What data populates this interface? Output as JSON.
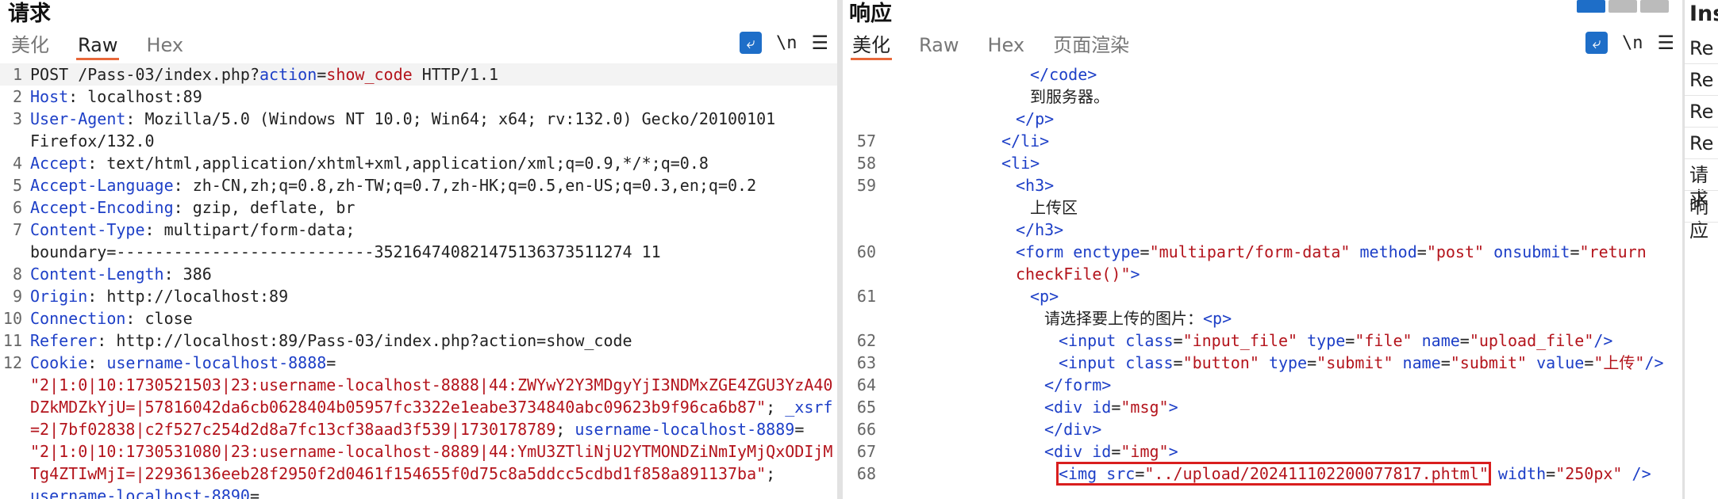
{
  "request": {
    "title": "请求",
    "tabs": [
      "美化",
      "Raw",
      "Hex"
    ],
    "active_tab": "Raw",
    "icons": {
      "wrap": "wrap-lines-icon",
      "newline": "\\n",
      "menu": "menu-icon"
    },
    "lines": [
      {
        "n": "1",
        "parts": [
          {
            "c": "txt",
            "t": "POST /Pass-03/index.php?"
          },
          {
            "c": "kw",
            "t": "action"
          },
          {
            "c": "txt",
            "t": "="
          },
          {
            "c": "val",
            "t": "show_code"
          },
          {
            "c": "txt",
            "t": " HTTP/1.1"
          }
        ],
        "first": true
      },
      {
        "n": "2",
        "parts": [
          {
            "c": "hdr",
            "t": "Host"
          },
          {
            "c": "txt",
            "t": ": localhost:89"
          }
        ]
      },
      {
        "n": "3",
        "parts": [
          {
            "c": "hdr",
            "t": "User-Agent"
          },
          {
            "c": "txt",
            "t": ": Mozilla/5.0 (Windows NT 10.0; Win64; x64; rv:132.0) Gecko/20100101"
          }
        ]
      },
      {
        "n": "",
        "parts": [
          {
            "c": "txt",
            "t": "Firefox/132.0"
          }
        ]
      },
      {
        "n": "4",
        "parts": [
          {
            "c": "hdr",
            "t": "Accept"
          },
          {
            "c": "txt",
            "t": ": text/html,application/xhtml+xml,application/xml;q=0.9,*/*;q=0.8"
          }
        ]
      },
      {
        "n": "5",
        "parts": [
          {
            "c": "hdr",
            "t": "Accept-Language"
          },
          {
            "c": "txt",
            "t": ": zh-CN,zh;q=0.8,zh-TW;q=0.7,zh-HK;q=0.5,en-US;q=0.3,en;q=0.2"
          }
        ]
      },
      {
        "n": "6",
        "parts": [
          {
            "c": "hdr",
            "t": "Accept-Encoding"
          },
          {
            "c": "txt",
            "t": ": gzip, deflate, br"
          }
        ]
      },
      {
        "n": "7",
        "parts": [
          {
            "c": "hdr",
            "t": "Content-Type"
          },
          {
            "c": "txt",
            "t": ": multipart/form-data;"
          }
        ]
      },
      {
        "n": "",
        "parts": [
          {
            "c": "txt",
            "t": "boundary=---------------------------352164740821475136373511274 11"
          }
        ]
      },
      {
        "n": "8",
        "parts": [
          {
            "c": "hdr",
            "t": "Content-Length"
          },
          {
            "c": "txt",
            "t": ": 386"
          }
        ]
      },
      {
        "n": "9",
        "parts": [
          {
            "c": "hdr",
            "t": "Origin"
          },
          {
            "c": "txt",
            "t": ": http://localhost:89"
          }
        ]
      },
      {
        "n": "10",
        "parts": [
          {
            "c": "hdr",
            "t": "Connection"
          },
          {
            "c": "txt",
            "t": ": close"
          }
        ]
      },
      {
        "n": "11",
        "parts": [
          {
            "c": "hdr",
            "t": "Referer"
          },
          {
            "c": "txt",
            "t": ": http://localhost:89/Pass-03/index.php?action=show_code"
          }
        ]
      },
      {
        "n": "12",
        "parts": [
          {
            "c": "hdr",
            "t": "Cookie"
          },
          {
            "c": "txt",
            "t": ": "
          },
          {
            "c": "kw",
            "t": "username-localhost-8888"
          },
          {
            "c": "txt",
            "t": "="
          }
        ]
      },
      {
        "n": "",
        "parts": [
          {
            "c": "val",
            "t": "\"2|1:0|10:1730521503|23:username-localhost-8888|44:ZWYwY2Y3MDgyYjI3NDMxZGE4ZGU3YzA40"
          }
        ]
      },
      {
        "n": "",
        "parts": [
          {
            "c": "val",
            "t": "DZkMDZkYjU=|57816042da6cb0628404b05957fc3322e1eabe3734840abc09623b9f96ca6b87\""
          },
          {
            "c": "txt",
            "t": "; "
          },
          {
            "c": "kw",
            "t": "_xsrf"
          }
        ]
      },
      {
        "n": "",
        "parts": [
          {
            "c": "val",
            "t": "=2|7bf02838|c2f527c254d2d8a7fc13cf38aad3f539|1730178789"
          },
          {
            "c": "txt",
            "t": "; "
          },
          {
            "c": "kw",
            "t": "username-localhost-8889"
          },
          {
            "c": "txt",
            "t": "="
          }
        ]
      },
      {
        "n": "",
        "parts": [
          {
            "c": "val",
            "t": "\"2|1:0|10:1730531080|23:username-localhost-8889|44:YmU3ZTliNjU2YTMONDZiNmIyMjQxODIjM"
          }
        ]
      },
      {
        "n": "",
        "parts": [
          {
            "c": "val",
            "t": "Tg4ZTIwMjI=|22936136eeb28f2950f2d0461f154655f0d75c8a5ddcc5cdbd1f858a891137ba\""
          },
          {
            "c": "txt",
            "t": ";"
          }
        ]
      },
      {
        "n": "",
        "parts": [
          {
            "c": "kw",
            "t": "username-localhost-8890"
          },
          {
            "c": "txt",
            "t": "="
          }
        ]
      }
    ]
  },
  "response": {
    "title": "响应",
    "tabs": [
      "美化",
      "Raw",
      "Hex",
      "页面渲染"
    ],
    "active_tab": "美化",
    "icons": {
      "wrap": "wrap-lines-icon",
      "newline": "\\n",
      "menu": "menu-icon"
    },
    "lines": [
      {
        "n": "",
        "indent": 20,
        "parts": [
          {
            "c": "tag",
            "t": "</code>"
          }
        ]
      },
      {
        "n": "",
        "indent": 20,
        "parts": [
          {
            "c": "txt",
            "t": "到服务器。"
          }
        ]
      },
      {
        "n": "",
        "indent": 18,
        "parts": [
          {
            "c": "tag",
            "t": "</p>"
          }
        ]
      },
      {
        "n": "57",
        "indent": 16,
        "parts": [
          {
            "c": "tag",
            "t": "</li>"
          }
        ]
      },
      {
        "n": "58",
        "indent": 16,
        "parts": [
          {
            "c": "tag",
            "t": "<li>"
          }
        ]
      },
      {
        "n": "59",
        "indent": 18,
        "parts": [
          {
            "c": "tag",
            "t": "<h3>"
          }
        ]
      },
      {
        "n": "",
        "indent": 20,
        "parts": [
          {
            "c": "txt",
            "t": "上传区"
          }
        ]
      },
      {
        "n": "",
        "indent": 18,
        "parts": [
          {
            "c": "tag",
            "t": "</h3>"
          }
        ]
      },
      {
        "n": "60",
        "indent": 18,
        "parts": [
          {
            "c": "tag",
            "t": "<form "
          },
          {
            "c": "attr",
            "t": "enctype"
          },
          {
            "c": "txt",
            "t": "="
          },
          {
            "c": "str",
            "t": "\"multipart/form-data\""
          },
          {
            "c": "txt",
            "t": " "
          },
          {
            "c": "attr",
            "t": "method"
          },
          {
            "c": "txt",
            "t": "="
          },
          {
            "c": "str",
            "t": "\"post\""
          },
          {
            "c": "txt",
            "t": " "
          },
          {
            "c": "attr",
            "t": "onsubmit"
          },
          {
            "c": "txt",
            "t": "="
          },
          {
            "c": "str",
            "t": "\"return"
          }
        ]
      },
      {
        "n": "",
        "indent": 18,
        "parts": [
          {
            "c": "str",
            "t": "checkFile()"
          },
          {
            "c": "str",
            "t": "\""
          },
          {
            "c": "tag",
            "t": ">"
          }
        ]
      },
      {
        "n": "61",
        "indent": 20,
        "parts": [
          {
            "c": "tag",
            "t": "<p>"
          }
        ]
      },
      {
        "n": "",
        "indent": 22,
        "parts": [
          {
            "c": "txt",
            "t": "请选择要上传的图片："
          },
          {
            "c": "tag",
            "t": "<p>"
          }
        ]
      },
      {
        "n": "62",
        "indent": 24,
        "parts": [
          {
            "c": "tag",
            "t": "<input "
          },
          {
            "c": "attr",
            "t": "class"
          },
          {
            "c": "txt",
            "t": "="
          },
          {
            "c": "str",
            "t": "\"input_file\""
          },
          {
            "c": "txt",
            "t": " "
          },
          {
            "c": "attr",
            "t": "type"
          },
          {
            "c": "txt",
            "t": "="
          },
          {
            "c": "str",
            "t": "\"file\""
          },
          {
            "c": "txt",
            "t": " "
          },
          {
            "c": "attr",
            "t": "name"
          },
          {
            "c": "txt",
            "t": "="
          },
          {
            "c": "str",
            "t": "\"upload_file\""
          },
          {
            "c": "tag",
            "t": "/>"
          }
        ]
      },
      {
        "n": "63",
        "indent": 24,
        "parts": [
          {
            "c": "tag",
            "t": "<input "
          },
          {
            "c": "attr",
            "t": "class"
          },
          {
            "c": "txt",
            "t": "="
          },
          {
            "c": "str",
            "t": "\"button\""
          },
          {
            "c": "txt",
            "t": " "
          },
          {
            "c": "attr",
            "t": "type"
          },
          {
            "c": "txt",
            "t": "="
          },
          {
            "c": "str",
            "t": "\"submit\""
          },
          {
            "c": "txt",
            "t": " "
          },
          {
            "c": "attr",
            "t": "name"
          },
          {
            "c": "txt",
            "t": "="
          },
          {
            "c": "str",
            "t": "\"submit\""
          },
          {
            "c": "txt",
            "t": " "
          },
          {
            "c": "attr",
            "t": "value"
          },
          {
            "c": "txt",
            "t": "="
          },
          {
            "c": "str",
            "t": "\"上传\""
          },
          {
            "c": "tag",
            "t": "/>"
          }
        ]
      },
      {
        "n": "64",
        "indent": 22,
        "parts": [
          {
            "c": "tag",
            "t": "</form>"
          }
        ]
      },
      {
        "n": "65",
        "indent": 22,
        "parts": [
          {
            "c": "tag",
            "t": "<div "
          },
          {
            "c": "attr",
            "t": "id"
          },
          {
            "c": "txt",
            "t": "="
          },
          {
            "c": "str",
            "t": "\"msg\""
          },
          {
            "c": "tag",
            "t": ">"
          }
        ]
      },
      {
        "n": "66",
        "indent": 22,
        "parts": [
          {
            "c": "tag",
            "t": "</div>"
          }
        ]
      },
      {
        "n": "67",
        "indent": 22,
        "parts": [
          {
            "c": "tag",
            "t": "<div "
          },
          {
            "c": "attr",
            "t": "id"
          },
          {
            "c": "txt",
            "t": "="
          },
          {
            "c": "str",
            "t": "\"img\""
          },
          {
            "c": "tag",
            "t": ">"
          }
        ]
      },
      {
        "n": "68",
        "indent": 24,
        "hl": true,
        "parts": [
          {
            "c": "tag",
            "t": "<img "
          },
          {
            "c": "attr",
            "t": "src"
          },
          {
            "c": "txt",
            "t": "="
          },
          {
            "c": "str",
            "t": "\"../upload/202411102200077817.phtml\""
          }
        ],
        "after": [
          {
            "c": "txt",
            "t": " "
          },
          {
            "c": "attr",
            "t": "width"
          },
          {
            "c": "txt",
            "t": "="
          },
          {
            "c": "str",
            "t": "\"250px\""
          },
          {
            "c": "txt",
            "t": " "
          },
          {
            "c": "tag",
            "t": "/>"
          }
        ]
      }
    ]
  },
  "inspector": {
    "title": "Ins",
    "items": [
      "Re",
      "Re",
      "Re",
      "Re",
      "请求",
      "响应"
    ]
  }
}
